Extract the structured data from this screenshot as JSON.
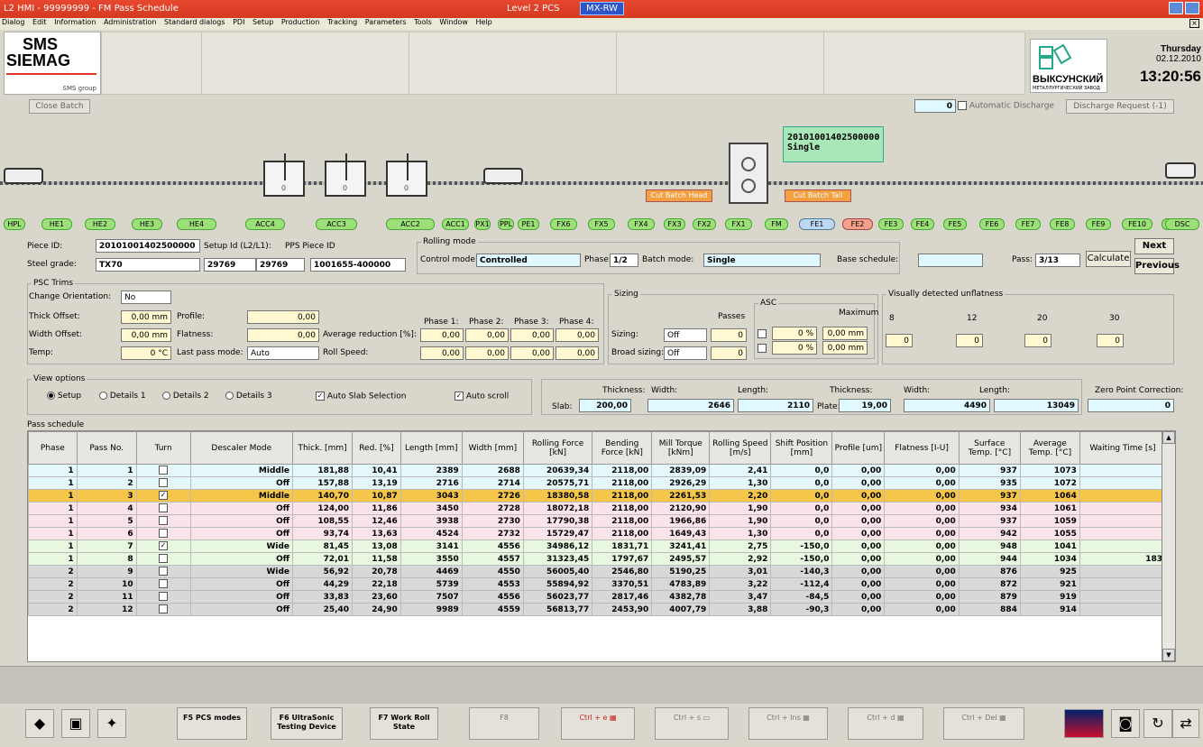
{
  "title": "L2 HMI - 99999999 - FM Pass Schedule",
  "level": "Level 2 PCS",
  "server": "MX-RW",
  "menu": [
    "Dialog",
    "Edit",
    "Information",
    "Administration",
    "Standard dialogs",
    "PDI",
    "Setup",
    "Production",
    "Tracking",
    "Parameters",
    "Tools",
    "Window",
    "Help"
  ],
  "logo": {
    "l1": "SMS",
    "l2": "SIEMAG",
    "l3": "SMS group"
  },
  "vyksa": {
    "name": "ВЫКСУНСКИЙ",
    "sub": "МЕТАЛЛУРГИЧЕСКИЙ ЗАВОД"
  },
  "datetime": {
    "day": "Thursday",
    "date": "02.12.2010",
    "time": "13:20:56"
  },
  "close_batch": "Close Batch",
  "discharge": {
    "count": "0",
    "auto": "Automatic Discharge",
    "request": "Discharge Request (-1)"
  },
  "batch": {
    "id": "20101001402500000",
    "mode": "Single"
  },
  "cut_head": "Cut Batch Head",
  "cut_tail": "Cut Batch Tail",
  "acc_zero": "0",
  "stations": [
    "HPL",
    "HE1",
    "HE2",
    "HE3",
    "HE4",
    "ACC4",
    "ACC3",
    "ACC2",
    "ACC1",
    "PX1",
    "PPL",
    "PE1",
    "FX6",
    "FX5",
    "FX4",
    "FX3",
    "FX2",
    "FX1",
    "FM",
    "FE1",
    "FE2",
    "FE3",
    "FE4",
    "FE5",
    "FE6",
    "FE7",
    "FE8",
    "FE9",
    "FE10",
    "FE11",
    "DSC"
  ],
  "piece": {
    "piece_id_lbl": "Piece ID:",
    "piece_id": "20101001402500000",
    "setup_lbl": "Setup Id (L2/L1):",
    "setup1": "29769",
    "setup2": "29769",
    "pps_lbl": "PPS Piece ID",
    "pps": "1001655-400000",
    "grade_lbl": "Steel grade:",
    "grade": "TX70",
    "rolling_mode": "Rolling mode",
    "control_lbl": "Control mode:",
    "control": "Controlled",
    "phase_lbl": "Phase:",
    "phase": "1/2",
    "batch_lbl": "Batch mode:",
    "batch": "Single",
    "base_lbl": "Base schedule:",
    "base": "",
    "pass_lbl": "Pass:",
    "pass": "3/13",
    "calculate": "Calculate",
    "next": "Next",
    "previous": "Previous"
  },
  "trims": {
    "title": "PSC Trims",
    "orient_lbl": "Change Orientation:",
    "orient": "No",
    "thick_lbl": "Thick Offset:",
    "thick": "0,00 mm",
    "width_lbl": "Width Offset:",
    "width": "0,00 mm",
    "temp_lbl": "Temp:",
    "temp": "0 °C",
    "profile_lbl": "Profile:",
    "profile": "0,00",
    "flat_lbl": "Flatness:",
    "flat": "0,00",
    "last_lbl": "Last pass mode:",
    "last": "Auto",
    "avgred_lbl": "Average reduction [%]:",
    "rollspd_lbl": "Roll Speed:",
    "phases": [
      "Phase 1:",
      "Phase 2:",
      "Phase 3:",
      "Phase 4:"
    ],
    "phase_val": "0,00"
  },
  "sizing": {
    "title": "Sizing",
    "passes": "Passes",
    "sizing_lbl": "Sizing:",
    "sizing": "Off",
    "sizing_n": "0",
    "broad_lbl": "Broad sizing:",
    "broad": "Off",
    "broad_n": "0",
    "asc": "ASC",
    "maximum": "Maximum",
    "pct": "0 %",
    "mm": "0,00 mm"
  },
  "unflat": {
    "title": "Visually detected unflatness",
    "vals": [
      "8",
      "12",
      "20",
      "30"
    ],
    "zero": "0"
  },
  "view": {
    "title": "View options",
    "setup": "Setup",
    "d1": "Details 1",
    "d2": "Details 2",
    "d3": "Details 3",
    "auto_slab": "Auto Slab Selection",
    "auto_scroll": "Auto scroll"
  },
  "dims": {
    "thick_lbl": "Thickness:",
    "width_lbl": "Width:",
    "length_lbl": "Length:",
    "slab_lbl": "Slab:",
    "slab_t": "200,00",
    "slab_w": "2646",
    "slab_l": "2110",
    "plate_lbl": "Plate:",
    "plate_t": "19,00",
    "plate_w": "4490",
    "plate_l": "13049",
    "zpc_lbl": "Zero Point Correction:",
    "zpc": "0"
  },
  "pass_schedule": "Pass schedule",
  "columns": [
    "Phase",
    "Pass No.",
    "Turn",
    "Descaler Mode",
    "Thick. [mm]",
    "Red. [%]",
    "Length [mm]",
    "Width [mm]",
    "Rolling Force [kN]",
    "Bending Force [kN]",
    "Mill Torque [kNm]",
    "Rolling Speed [m/s]",
    "Shift Position [mm]",
    "Profile [um]",
    "Flatness [I-U]",
    "Surface Temp. [°C]",
    "Average Temp. [°C]",
    "Waiting Time [s]"
  ],
  "rows": [
    [
      "1",
      "1",
      "",
      "Middle",
      "181,88",
      "10,41",
      "2389",
      "2688",
      "20639,34",
      "2118,00",
      "2839,09",
      "2,41",
      "0,0",
      "0,00",
      "0,00",
      "937",
      "1073",
      ""
    ],
    [
      "1",
      "2",
      "",
      "Off",
      "157,88",
      "13,19",
      "2716",
      "2714",
      "20575,71",
      "2118,00",
      "2926,29",
      "1,30",
      "0,0",
      "0,00",
      "0,00",
      "935",
      "1072",
      ""
    ],
    [
      "1",
      "3",
      "x",
      "Middle",
      "140,70",
      "10,87",
      "3043",
      "2726",
      "18380,58",
      "2118,00",
      "2261,53",
      "2,20",
      "0,0",
      "0,00",
      "0,00",
      "937",
      "1064",
      ""
    ],
    [
      "1",
      "4",
      "",
      "Off",
      "124,00",
      "11,86",
      "3450",
      "2728",
      "18072,18",
      "2118,00",
      "2120,90",
      "1,90",
      "0,0",
      "0,00",
      "0,00",
      "934",
      "1061",
      ""
    ],
    [
      "1",
      "5",
      "",
      "Off",
      "108,55",
      "12,46",
      "3938",
      "2730",
      "17790,38",
      "2118,00",
      "1966,86",
      "1,90",
      "0,0",
      "0,00",
      "0,00",
      "937",
      "1059",
      ""
    ],
    [
      "1",
      "6",
      "",
      "Off",
      "93,74",
      "13,63",
      "4524",
      "2732",
      "15729,47",
      "2118,00",
      "1649,43",
      "1,30",
      "0,0",
      "0,00",
      "0,00",
      "942",
      "1055",
      ""
    ],
    [
      "1",
      "7",
      "x",
      "Wide",
      "81,45",
      "13,08",
      "3141",
      "4556",
      "34986,12",
      "1831,71",
      "3241,41",
      "2,75",
      "-150,0",
      "0,00",
      "0,00",
      "948",
      "1041",
      ""
    ],
    [
      "1",
      "8",
      "",
      "Off",
      "72,01",
      "11,58",
      "3550",
      "4557",
      "31323,45",
      "1797,67",
      "2495,57",
      "2,92",
      "-150,0",
      "0,00",
      "0,00",
      "944",
      "1034",
      "183"
    ],
    [
      "2",
      "9",
      "",
      "Wide",
      "56,92",
      "20,78",
      "4469",
      "4550",
      "56005,40",
      "2546,80",
      "5190,25",
      "3,01",
      "-140,3",
      "0,00",
      "0,00",
      "876",
      "925",
      ""
    ],
    [
      "2",
      "10",
      "",
      "Off",
      "44,29",
      "22,18",
      "5739",
      "4553",
      "55894,92",
      "3370,51",
      "4783,89",
      "3,22",
      "-112,4",
      "0,00",
      "0,00",
      "872",
      "921",
      ""
    ],
    [
      "2",
      "11",
      "",
      "Off",
      "33,83",
      "23,60",
      "7507",
      "4556",
      "56023,77",
      "2817,46",
      "4382,78",
      "3,47",
      "-84,5",
      "0,00",
      "0,00",
      "879",
      "919",
      ""
    ],
    [
      "2",
      "12",
      "",
      "Off",
      "25,40",
      "24,90",
      "9989",
      "4559",
      "56813,77",
      "2453,90",
      "4007,79",
      "3,88",
      "-90,3",
      "0,00",
      "0,00",
      "884",
      "914",
      ""
    ]
  ],
  "row_colors": [
    "#e4f8fc",
    "#e4f8fc",
    "#f6c64a",
    "#fbe3ea",
    "#fbe3ea",
    "#fbe3ea",
    "#e8f8e0",
    "#e8f8e0",
    "#d8d8d8",
    "#d8d8d8",
    "#d8d8d8",
    "#d8d8d8"
  ],
  "fkeys": [
    {
      "k": "F5",
      "t": "PCS modes"
    },
    {
      "k": "F6",
      "t": "UltraSonic Testing Device"
    },
    {
      "k": "F7",
      "t": "Work Roll State"
    },
    {
      "k": "F8",
      "t": ""
    },
    {
      "k": "Ctrl + e",
      "t": ""
    },
    {
      "k": "Ctrl + s",
      "t": ""
    },
    {
      "k": "Ctrl + Ins",
      "t": ""
    },
    {
      "k": "Ctrl + d",
      "t": ""
    },
    {
      "k": "Ctrl + Del",
      "t": ""
    }
  ]
}
